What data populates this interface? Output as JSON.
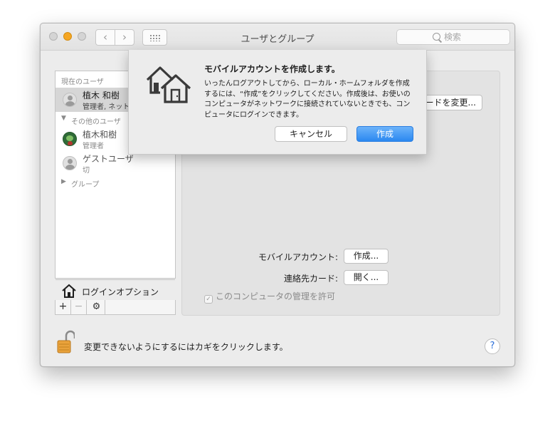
{
  "window": {
    "title": "ユーザとグループ",
    "search_placeholder": "検索"
  },
  "sidebar": {
    "current_users_label": "現在のユーザ",
    "current_user": {
      "name": "植木 和樹",
      "sub": "管理者, ネットワ"
    },
    "other_users_label": "その他のユーザ",
    "other_users": [
      {
        "name": "植木和樹",
        "sub": "管理者"
      },
      {
        "name": "ゲストユーザ",
        "sub": "切"
      }
    ],
    "groups_label": "グループ",
    "login_options_label": "ログインオプション",
    "bar": {
      "add": "+",
      "remove": "−",
      "gear": "⚙"
    }
  },
  "panel": {
    "change_password_label": "ードを変更...",
    "mobile_account_label": "モバイルアカウント:",
    "mobile_account_button": "作成...",
    "contact_card_label": "連絡先カード:",
    "contact_card_button": "開く...",
    "allow_admin_label": "このコンピュータの管理を許可",
    "allow_admin_checked": true
  },
  "footer": {
    "lock_message": "変更できないようにするにはカギをクリックします。",
    "help": "?"
  },
  "sheet": {
    "title": "モバイルアカウントを作成します。",
    "message": "いったんログアウトしてから、ローカル・ホームフォルダを作成するには、“作成”をクリックしてください。作成後は、お使いのコンピュータがネットワークに接続されていないときでも、コンピュータにログインできます。",
    "cancel_label": "キャンセル",
    "create_label": "作成"
  },
  "colors": {
    "accent": "#2b88f0",
    "window_bg": "#ececec",
    "minimize": "#f5a623"
  },
  "icons": {
    "sheet": "home-folder-icon",
    "lock": "padlock-unlocked-icon",
    "search": "search-icon"
  }
}
